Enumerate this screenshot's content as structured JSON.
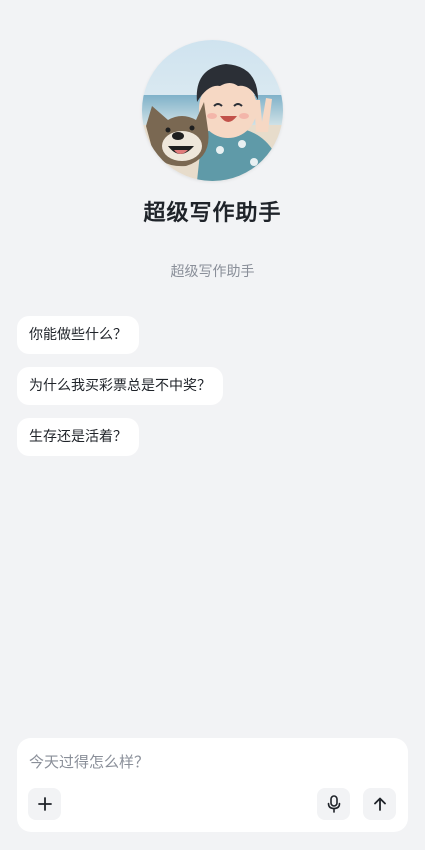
{
  "header": {
    "title": "超级写作助手",
    "subtitle": "超级写作助手"
  },
  "suggestions": [
    {
      "label": "你能做些什么？"
    },
    {
      "label": "为什么我买彩票总是不中奖？"
    },
    {
      "label": "生存还是活着？"
    }
  ],
  "composer": {
    "placeholder": "今天过得怎么样？",
    "value": ""
  },
  "icons": {
    "add": "plus-icon",
    "mic": "microphone-icon",
    "send": "arrow-up-icon"
  },
  "colors": {
    "background": "#f2f3f5",
    "card": "#ffffff",
    "text": "#1f2329",
    "muted": "#8a8f99"
  }
}
